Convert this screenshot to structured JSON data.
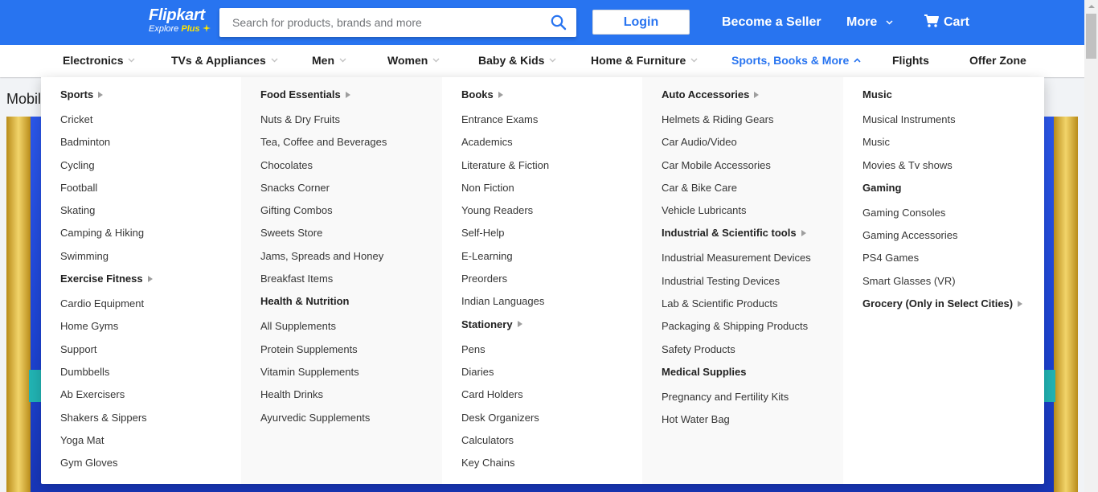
{
  "header": {
    "logo_main": "Flipkart",
    "logo_sub_text": "Explore",
    "logo_sub_plus": "Plus",
    "search_placeholder": "Search for products, brands and more",
    "login_label": "Login",
    "become_seller": "Become a Seller",
    "more": "More",
    "cart": "Cart",
    "brand_color": "#2874f0"
  },
  "nav": [
    {
      "label": "Electronics"
    },
    {
      "label": "TVs & Appliances"
    },
    {
      "label": "Men"
    },
    {
      "label": "Women"
    },
    {
      "label": "Baby & Kids"
    },
    {
      "label": "Home & Furniture"
    },
    {
      "label": "Sports, Books & More"
    },
    {
      "label": "Flights"
    },
    {
      "label": "Offer Zone"
    }
  ],
  "background": {
    "page_title_partial": "Mobil"
  },
  "menu": {
    "columns": [
      {
        "groups": [
          {
            "title": "Sports",
            "has_arrow": true,
            "items": [
              "Cricket",
              "Badminton",
              "Cycling",
              "Football",
              "Skating",
              "Camping & Hiking",
              "Swimming"
            ]
          },
          {
            "title": "Exercise Fitness",
            "has_arrow": true,
            "items": [
              "Cardio Equipment",
              "Home Gyms",
              "Support",
              "Dumbbells",
              "Ab Exercisers",
              "Shakers & Sippers",
              "Yoga Mat",
              "Gym Gloves"
            ]
          }
        ]
      },
      {
        "groups": [
          {
            "title": "Food Essentials",
            "has_arrow": true,
            "items": [
              "Nuts & Dry Fruits",
              "Tea, Coffee and Beverages",
              "Chocolates",
              "Snacks Corner",
              "Gifting Combos",
              "Sweets Store",
              "Jams, Spreads and Honey",
              "Breakfast Items"
            ]
          },
          {
            "title": "Health & Nutrition",
            "has_arrow": false,
            "items": [
              "All Supplements",
              "Protein Supplements",
              "Vitamin Supplements",
              "Health Drinks",
              "Ayurvedic Supplements"
            ]
          }
        ]
      },
      {
        "groups": [
          {
            "title": "Books",
            "has_arrow": true,
            "items": [
              "Entrance Exams",
              "Academics",
              "Literature & Fiction",
              "Non Fiction",
              "Young Readers",
              "Self-Help",
              "E-Learning",
              "Preorders",
              "Indian Languages"
            ]
          },
          {
            "title": "Stationery",
            "has_arrow": true,
            "items": [
              "Pens",
              "Diaries",
              "Card Holders",
              "Desk Organizers",
              "Calculators",
              "Key Chains"
            ]
          }
        ]
      },
      {
        "groups": [
          {
            "title": "Auto Accessories",
            "has_arrow": true,
            "items": [
              "Helmets & Riding Gears",
              "Car Audio/Video",
              "Car Mobile Accessories",
              "Car & Bike Care",
              "Vehicle Lubricants"
            ]
          },
          {
            "title": "Industrial & Scientific tools",
            "has_arrow": true,
            "items": [
              "Industrial Measurement Devices",
              "Industrial Testing Devices",
              "Lab & Scientific Products",
              "Packaging & Shipping Products",
              "Safety Products"
            ]
          },
          {
            "title": "Medical Supplies",
            "has_arrow": false,
            "items": [
              "Pregnancy and Fertility Kits",
              "Hot Water Bag"
            ]
          }
        ]
      },
      {
        "groups": [
          {
            "title": "Music",
            "has_arrow": false,
            "items": [
              "Musical Instruments",
              "Music",
              "Movies & Tv shows"
            ]
          },
          {
            "title": "Gaming",
            "has_arrow": false,
            "items": [
              "Gaming Consoles",
              "Gaming Accessories",
              "PS4 Games",
              "Smart Glasses (VR)"
            ]
          },
          {
            "title": "Grocery (Only in Select Cities)",
            "has_arrow": true,
            "items": []
          }
        ]
      }
    ]
  }
}
